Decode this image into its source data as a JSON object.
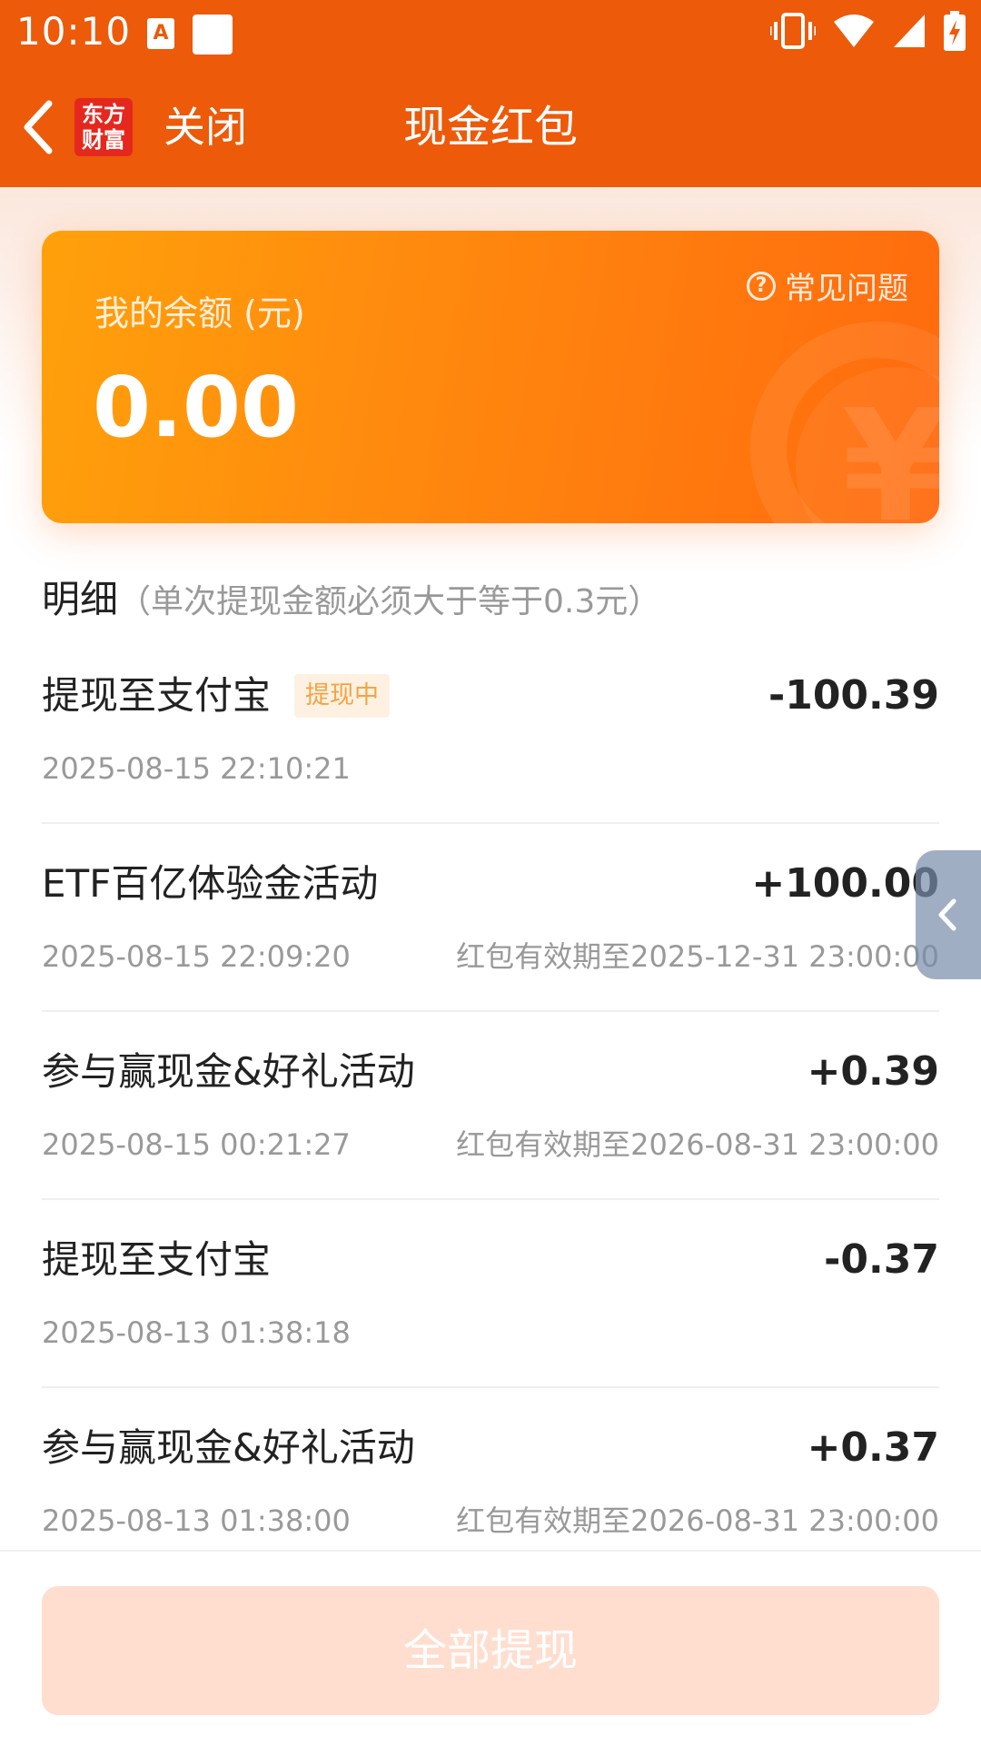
{
  "status_bar": {
    "time": "10:10",
    "app_icon_letter": "A"
  },
  "header": {
    "logo_line1": "东方",
    "logo_line2": "财富",
    "close_label": "关闭",
    "title": "现金红包"
  },
  "balance": {
    "faq_label": "常见问题",
    "label": "我的余额 (元)",
    "value": "0.00"
  },
  "details": {
    "title": "明细",
    "note": "（单次提现金额必须大于等于0.3元）"
  },
  "records": [
    {
      "title": "提现至支付宝",
      "badge": "提现中",
      "amount": "-100.39",
      "time": "2025-08-15 22:10:21",
      "expiry": ""
    },
    {
      "title": "ETF百亿体验金活动",
      "badge": "",
      "amount": "+100.00",
      "time": "2025-08-15 22:09:20",
      "expiry": "红包有效期至2025-12-31 23:00:00"
    },
    {
      "title": "参与赢现金&好礼活动",
      "badge": "",
      "amount": "+0.39",
      "time": "2025-08-15 00:21:27",
      "expiry": "红包有效期至2026-08-31 23:00:00"
    },
    {
      "title": "提现至支付宝",
      "badge": "",
      "amount": "-0.37",
      "time": "2025-08-13 01:38:18",
      "expiry": ""
    },
    {
      "title": "参与赢现金&好礼活动",
      "badge": "",
      "amount": "+0.37",
      "time": "2025-08-13 01:38:00",
      "expiry": "红包有效期至2026-08-31 23:00:00"
    }
  ],
  "bottom": {
    "withdraw_all_label": "全部提现"
  },
  "colors": {
    "brand_orange": "#EC5A0A",
    "card_start": "#FFA10B",
    "card_end": "#FF6A0E",
    "badge_bg": "#FFF1E2",
    "badge_text": "#F3A443",
    "button_disabled_bg": "#FFDECF"
  },
  "icons": {
    "back": "chevron-left-icon",
    "faq": "question-circle-icon",
    "side_tab": "chevron-left-icon",
    "vibrate": "vibrate-icon",
    "wifi": "wifi-icon",
    "signal": "signal-icon",
    "battery": "battery-charging-icon"
  }
}
